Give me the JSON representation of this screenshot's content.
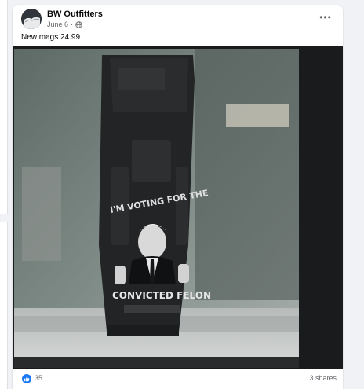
{
  "post": {
    "page_name": "BW Outfitters",
    "date": "June 6",
    "separator": "·",
    "text": "New mags 24.99",
    "more_label": "•••",
    "photo": {
      "caption_top": "I'M VOTING FOR THE",
      "caption_bottom": "CONVICTED FELON"
    },
    "reactions": {
      "count": "35"
    },
    "shares_label": "3 shares"
  },
  "colors": {
    "facebook_blue": "#1877f2",
    "secondary_text": "#65676b"
  },
  "icons": [
    "globe-icon",
    "more-options-icon",
    "like-icon"
  ]
}
